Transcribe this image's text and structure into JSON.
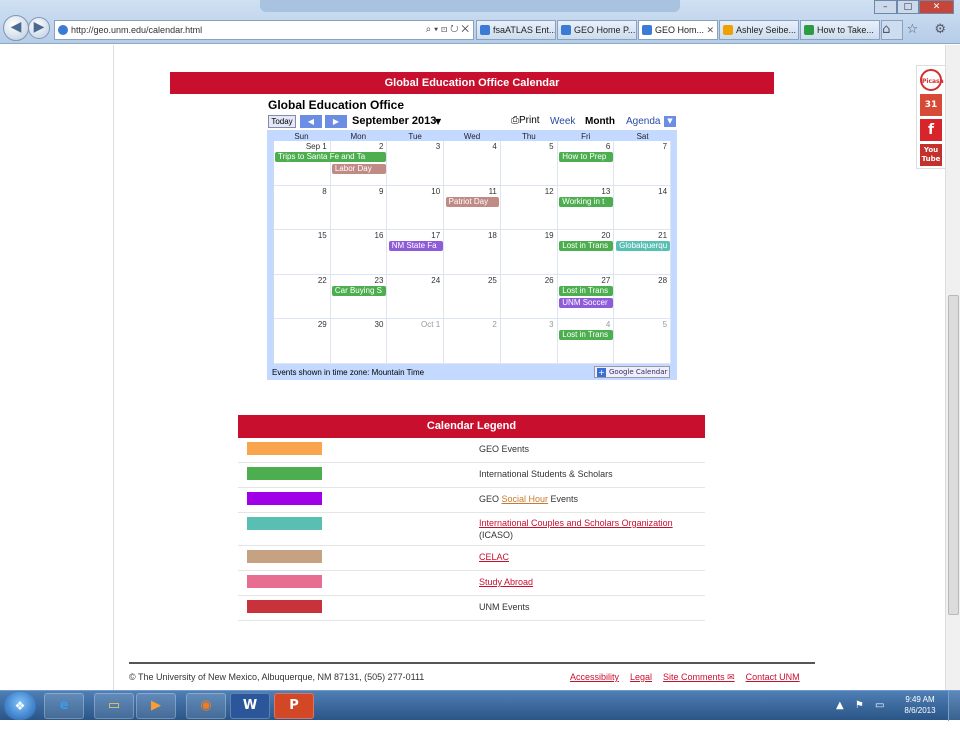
{
  "browser": {
    "address": "http://geo.unm.edu/calendar.html",
    "address_controls": "⌕ ▾ ⊡ ↻ ✕",
    "tabs": [
      "fsaATLAS Ent...",
      "GEO Home P...",
      "GEO Hom...",
      "Ashley Seibe...",
      "How to Take..."
    ],
    "active_tab": 2,
    "tools": "⌂ ☆ ⚙",
    "window_controls": [
      "–",
      "□",
      "✕"
    ]
  },
  "social": [
    "Picasa",
    "31",
    "f",
    "You Tube"
  ],
  "calendar_bar_title": "Global Education Office Calendar",
  "calendar": {
    "name": "Global Education Office",
    "today_label": "Today",
    "prev": "◀",
    "next": "▶",
    "month_title": "September 2013",
    "dropdown": "▼",
    "print_label": "Print",
    "view_tabs": [
      "Week",
      "Month",
      "Agenda"
    ],
    "active_view": "Month",
    "dow": [
      "Sun",
      "Mon",
      "Tue",
      "Wed",
      "Thu",
      "Fri",
      "Sat"
    ],
    "weeks": [
      [
        "Sep 1",
        "2",
        "3",
        "4",
        "5",
        "6",
        "7"
      ],
      [
        "8",
        "9",
        "10",
        "11",
        "12",
        "13",
        "14"
      ],
      [
        "15",
        "16",
        "17",
        "18",
        "19",
        "20",
        "21"
      ],
      [
        "22",
        "23",
        "24",
        "25",
        "26",
        "27",
        "28"
      ],
      [
        "29",
        "30",
        "Oct 1",
        "2",
        "3",
        "4",
        "5"
      ]
    ],
    "other_month": [
      [],
      [],
      [],
      [],
      [
        2,
        3,
        4,
        5,
        6
      ]
    ],
    "events": [
      {
        "week": 0,
        "day": 0,
        "span": 2,
        "row": 0,
        "label": "Trips to Santa Fe and Ta",
        "color": "#4cae4f"
      },
      {
        "week": 0,
        "day": 1,
        "span": 1,
        "row": 1,
        "label": "Labor Day",
        "color": "#c08a85"
      },
      {
        "week": 0,
        "day": 5,
        "span": 1,
        "row": 0,
        "label": "How to Prep",
        "color": "#4cae4f"
      },
      {
        "week": 1,
        "day": 3,
        "span": 1,
        "row": 0,
        "label": "Patriot Day",
        "color": "#c08a85"
      },
      {
        "week": 1,
        "day": 5,
        "span": 1,
        "row": 0,
        "label": "Working in t",
        "color": "#4cae4f"
      },
      {
        "week": 2,
        "day": 2,
        "span": 1,
        "row": 0,
        "label": "NM State Fa",
        "color": "#8e5cd9"
      },
      {
        "week": 2,
        "day": 5,
        "span": 1,
        "row": 0,
        "label": "Lost in Trans",
        "color": "#4cae4f"
      },
      {
        "week": 2,
        "day": 6,
        "span": 1,
        "row": 0,
        "label": "Globalquerqu",
        "color": "#59bfb3"
      },
      {
        "week": 3,
        "day": 1,
        "span": 1,
        "row": 0,
        "label": "Car Buying S",
        "color": "#4cae4f"
      },
      {
        "week": 3,
        "day": 5,
        "span": 1,
        "row": 0,
        "label": "Lost in Trans",
        "color": "#4cae4f"
      },
      {
        "week": 3,
        "day": 5,
        "span": 1,
        "row": 1,
        "label": "UNM Soccer",
        "color": "#8e5cd9"
      },
      {
        "week": 4,
        "day": 5,
        "span": 1,
        "row": 0,
        "label": "Lost in Trans",
        "color": "#4cae4f"
      }
    ],
    "timezone_note": "Events shown in time zone: Mountain Time",
    "gcal_badge": "Google Calendar",
    "gcal_plus": "+"
  },
  "legend_title": "Calendar Legend",
  "legend": [
    {
      "color": "#f9a54d",
      "parts": [
        {
          "t": "GEO Events"
        }
      ]
    },
    {
      "color": "#4cae4f",
      "parts": [
        {
          "t": "International Students & Scholars"
        }
      ]
    },
    {
      "color": "#a000e8",
      "parts": [
        {
          "t": "GEO "
        },
        {
          "t": "Social Hour",
          "link": "orange"
        },
        {
          "t": " Events"
        }
      ]
    },
    {
      "color": "#59bfb3",
      "parts": [
        {
          "t": "International Couples and Scholars Organization",
          "link": "red"
        },
        {
          "t": "(ICASO)",
          "br": true
        }
      ]
    },
    {
      "color": "#c5a282",
      "parts": [
        {
          "t": "CELAC",
          "link": "red"
        }
      ]
    },
    {
      "color": "#e86e91",
      "parts": [
        {
          "t": "Study Abroad",
          "link": "red"
        }
      ]
    },
    {
      "color": "#c8323a",
      "parts": [
        {
          "t": "UNM Events"
        }
      ]
    }
  ],
  "footer": {
    "copyright": "© The University of New Mexico, Albuquerque, NM 87131, (505) 277-0111",
    "links": [
      "Accessibility",
      "Legal",
      "Site Comments ✉",
      "Contact UNM"
    ]
  },
  "taskbar": {
    "start": "❖",
    "apps": [
      "e",
      "▭",
      "▶",
      "◉",
      "W",
      "P"
    ],
    "tray": "▲ ⚑ ▭ ♪",
    "time": "9:49 AM",
    "date": "8/6/2013"
  }
}
